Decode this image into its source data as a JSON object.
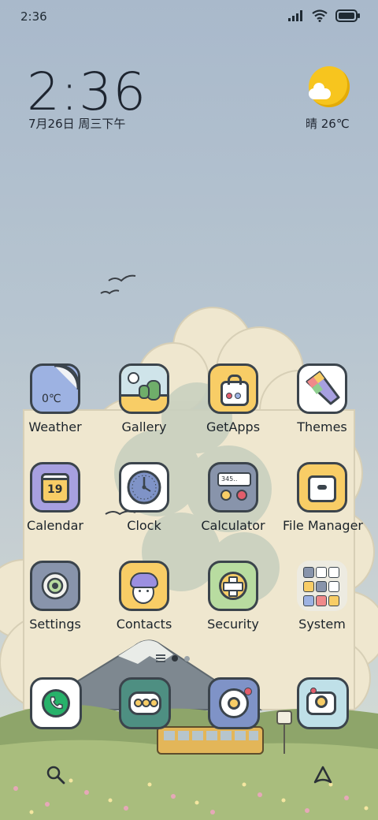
{
  "status_bar": {
    "time": "2:36",
    "icons": [
      "signal-icon",
      "wifi-icon",
      "battery-icon"
    ]
  },
  "clock_widget": {
    "time": "2:36",
    "date": "7月26日 周三下午"
  },
  "weather_widget": {
    "condition": "晴",
    "temperature": "晴 26℃"
  },
  "apps": [
    {
      "label": "Weather",
      "icon_text": "0℃"
    },
    {
      "label": "Gallery"
    },
    {
      "label": "GetApps"
    },
    {
      "label": "Themes"
    },
    {
      "label": "Calendar",
      "icon_text": "19"
    },
    {
      "label": "Clock"
    },
    {
      "label": "Calculator",
      "icon_text": "345.."
    },
    {
      "label": "File Manager"
    },
    {
      "label": "Settings"
    },
    {
      "label": "Contacts"
    },
    {
      "label": "Security"
    },
    {
      "label": "System"
    }
  ],
  "dock": [
    "phone-icon",
    "messages-icon",
    "browser-icon",
    "camera-icon"
  ],
  "bottom_bar": [
    "search-icon",
    "assistant-icon"
  ],
  "colors": {
    "icon_outline": "#3b444c",
    "yellow": "#f8cd66",
    "blue": "#9db2e2",
    "green": "#b8dca0",
    "teal": "#4e8f82"
  }
}
